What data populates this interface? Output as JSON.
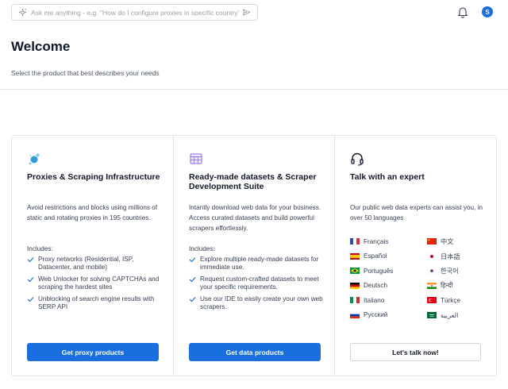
{
  "search": {
    "placeholder": "Ask me anything - e.g. \"How do I configure proxies in specific country?\"",
    "value": ""
  },
  "user": {
    "avatar_initial": "S"
  },
  "page": {
    "title": "Welcome",
    "subtitle": "Select the product that best describes your needs"
  },
  "cards": [
    {
      "icon": "proxy-network-icon",
      "title": "Proxies & Scraping Infrastructure",
      "description": "Avoid restrictions and blocks using millions of static and rotating proxies in 195 countries.",
      "includes_label": "Includes:",
      "features": [
        "Proxy networks (Residential, ISP, Datacenter, and mobile)",
        "Web Unlocker for solving CAPTCHAs and scraping the hardest sites",
        "Unblocking of search engine results with SERP API"
      ],
      "button_label": "Get proxy products"
    },
    {
      "icon": "dataset-table-icon",
      "title": "Ready-made datasets & Scraper Development Suite",
      "description": "Intantly download web data for your business. Access curated datasets and build powerful scrapers effortlessly.",
      "includes_label": "Includes:",
      "features": [
        "Explore multiple ready-made datasets for immediate use.",
        "Request custom-crafted datasets to meet your specific requirements.",
        "Use our IDE to easily create your own web scrapers."
      ],
      "button_label": "Get data products"
    },
    {
      "icon": "headset-icon",
      "title": "Talk with an expert",
      "description": "Our public web data experts can assist you, in over 50 languages",
      "languages": [
        "Français",
        "中文",
        "Español",
        "日本語",
        "Português",
        "한국어",
        "Deutsch",
        "हिन्दी",
        "Italiano",
        "Türkçe",
        "Русский",
        "العربية"
      ],
      "button_label": "Let's talk now!"
    }
  ],
  "colors": {
    "primary": "#1a6fdf",
    "border": "#e3e6eb",
    "text": "#111827"
  }
}
